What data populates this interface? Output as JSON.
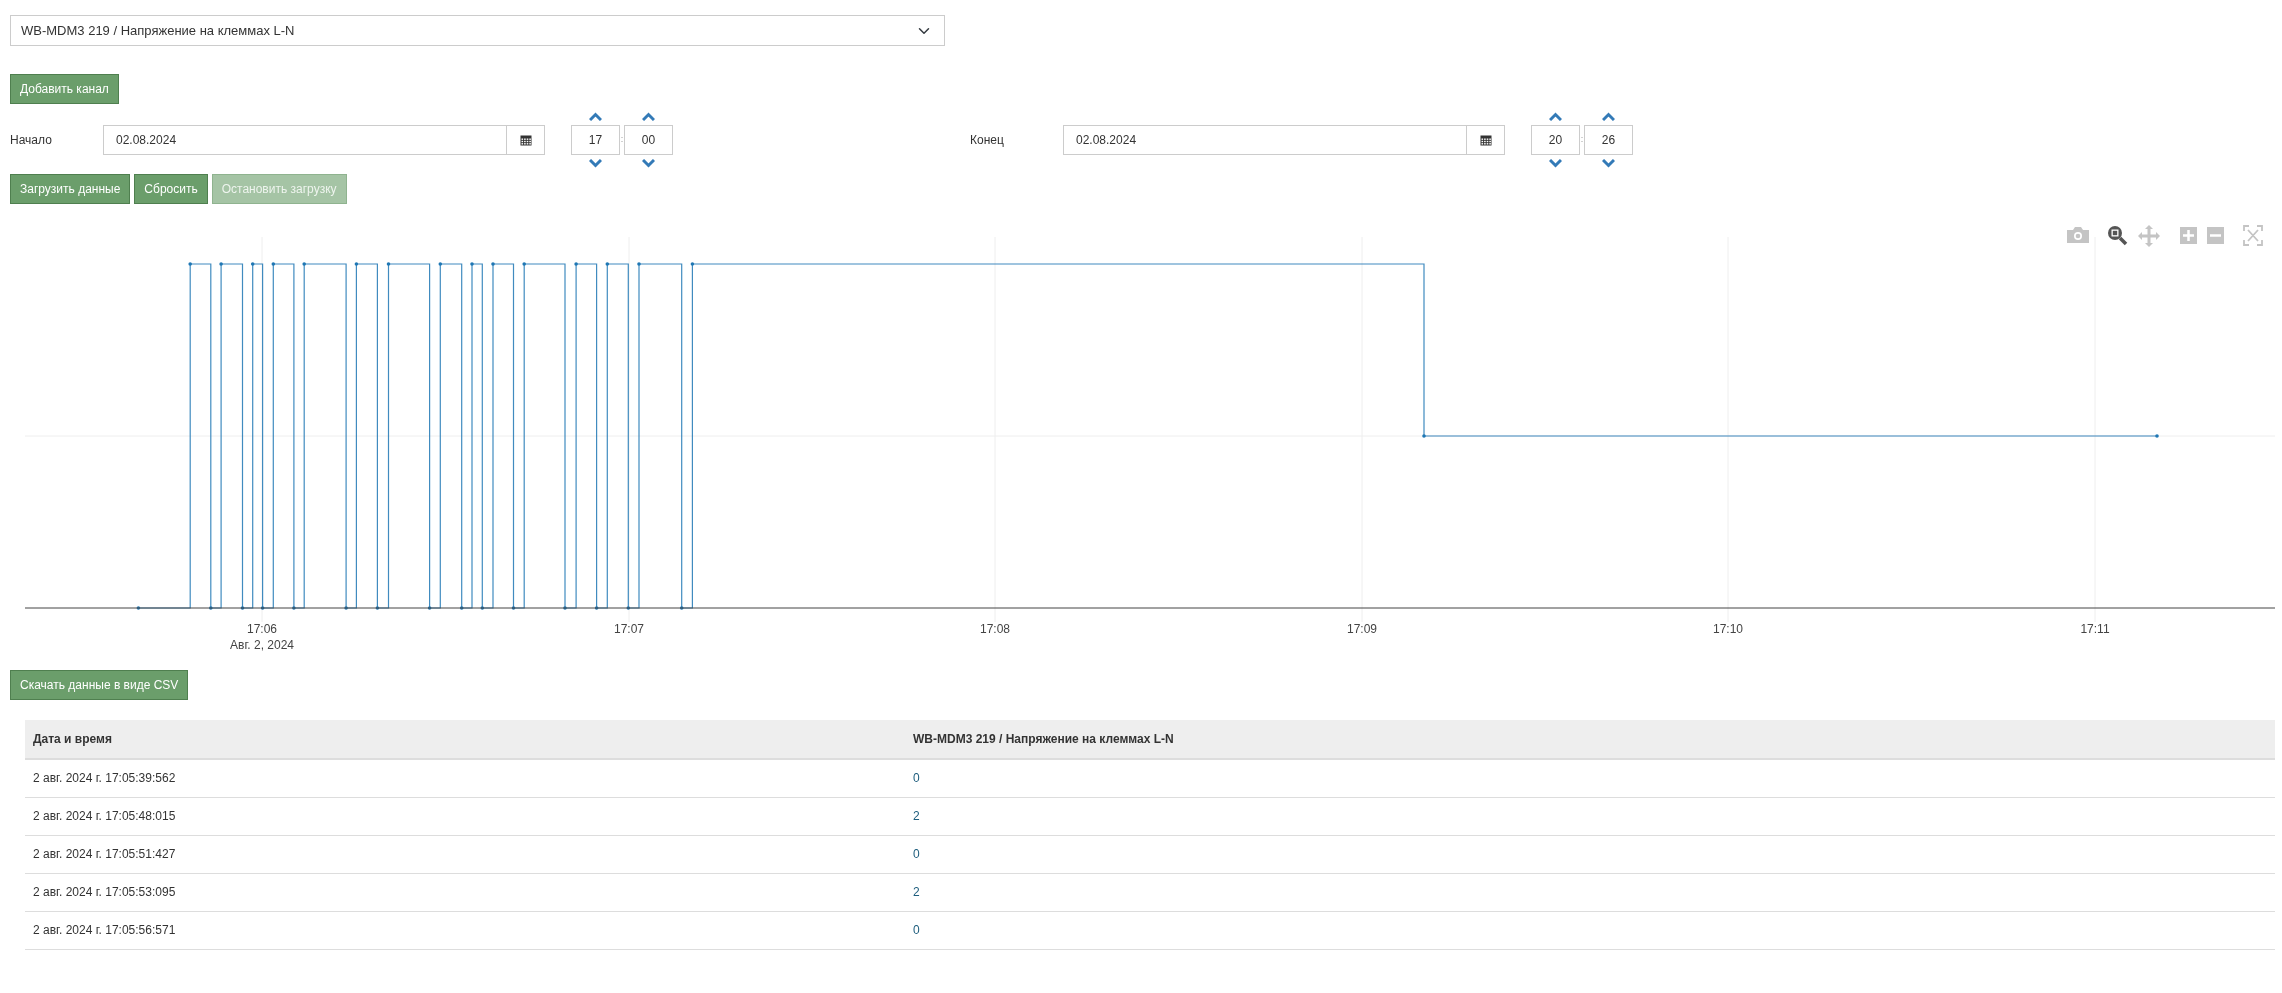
{
  "channel_select": {
    "value": "WB-MDM3 219 / Напряжение на клеммах L-N"
  },
  "add_channel_button": "Добавить канал",
  "range": [
    {
      "label": "Начало",
      "date": "02.08.2024",
      "hours": "17",
      "separator": ":",
      "minutes": "00"
    },
    {
      "label": "Конец",
      "date": "02.08.2024",
      "hours": "20",
      "separator": ":",
      "minutes": "26"
    }
  ],
  "actions": [
    {
      "label": "Загрузить данные",
      "disabled": false
    },
    {
      "label": "Сбросить",
      "disabled": false
    },
    {
      "label": "Остановить загрузку",
      "disabled": true
    }
  ],
  "chart": {
    "modebar": [
      {
        "kind": "camera",
        "selected": false
      },
      {
        "kind": "zoom",
        "selected": true
      },
      {
        "kind": "pan",
        "selected": false
      },
      {
        "kind": "zoom-in",
        "selected": false
      },
      {
        "kind": "zoom-out",
        "selected": false
      },
      {
        "kind": "autoscale",
        "selected": false
      }
    ],
    "x_tick_labels": [
      "17:06",
      "17:07",
      "17:08",
      "17:09",
      "17:10",
      "17:11"
    ],
    "date_label": "Авг. 2, 2024"
  },
  "csv_button": "Скачать данные в виде CSV",
  "table": {
    "columns": [
      "Дата и время",
      "WB-MDM3 219 / Напряжение на клеммах L-N"
    ],
    "rows": [
      [
        "2 авг. 2024 г. 17:05:39:562",
        "0"
      ],
      [
        "2 авг. 2024 г. 17:05:48:015",
        "2"
      ],
      [
        "2 авг. 2024 г. 17:05:51:427",
        "0"
      ],
      [
        "2 авг. 2024 г. 17:05:53:095",
        "2"
      ],
      [
        "2 авг. 2024 г. 17:05:56:571",
        "0"
      ]
    ]
  }
}
